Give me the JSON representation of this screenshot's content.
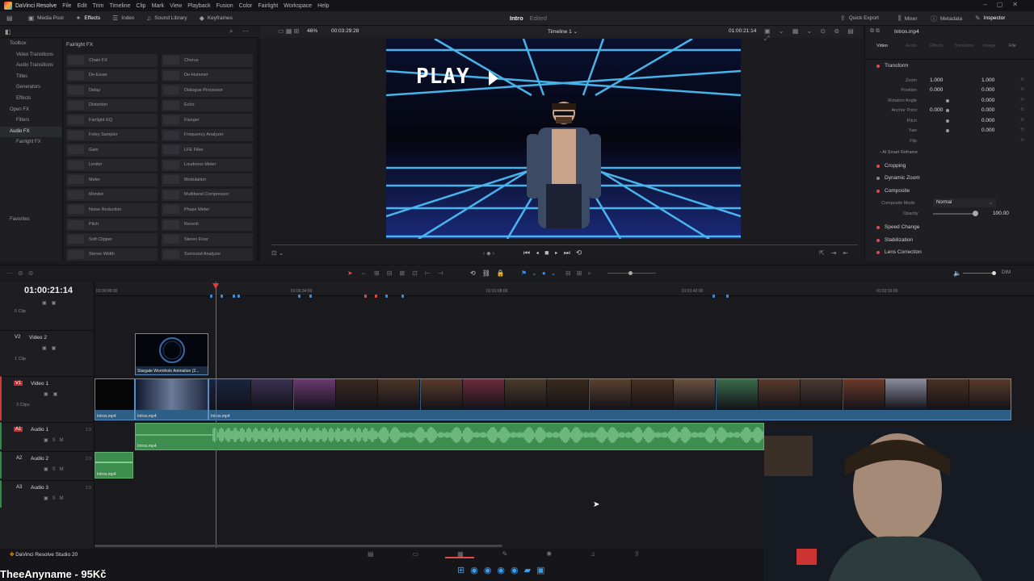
{
  "menu": {
    "app": "DaVinci Resolve",
    "items": [
      "File",
      "Edit",
      "Trim",
      "Timeline",
      "Clip",
      "Mark",
      "View",
      "Playback",
      "Fusion",
      "Color",
      "Fairlight",
      "Workspace",
      "Help"
    ]
  },
  "toolbar": {
    "left": [
      "Media Pool",
      "Effects",
      "Index",
      "Sound Library",
      "Keyframes"
    ],
    "project_name": "Intro",
    "project_status": "Edited",
    "right": [
      "Quick Export",
      "Mixer",
      "Metadata",
      "Inspector"
    ]
  },
  "effects": {
    "panel_title": "Fairlight FX",
    "tree": [
      {
        "label": "Toolbox",
        "indent": 0,
        "selected": false
      },
      {
        "label": "Video Transitions",
        "indent": 1,
        "selected": false
      },
      {
        "label": "Audio Transitions",
        "indent": 1,
        "selected": false
      },
      {
        "label": "Titles",
        "indent": 1,
        "selected": false
      },
      {
        "label": "Generators",
        "indent": 1,
        "selected": false
      },
      {
        "label": "Effects",
        "indent": 1,
        "selected": false
      },
      {
        "label": "Open FX",
        "indent": 0,
        "selected": false
      },
      {
        "label": "Filters",
        "indent": 1,
        "selected": false
      },
      {
        "label": "Audio FX",
        "indent": 0,
        "selected": true
      },
      {
        "label": "Fairlight FX",
        "indent": 1,
        "selected": false
      }
    ],
    "favorites_label": "Favorites",
    "items": [
      "Chain FX",
      "Chorus",
      "De-Esser",
      "De-Hummer",
      "Delay",
      "Dialogue Processor",
      "Distortion",
      "Echo",
      "Fairlight EQ",
      "Flanger",
      "Foley Sampler",
      "Frequency Analyzer",
      "Gain",
      "LFE Filter",
      "Limiter",
      "Loudness Meter",
      "Meter",
      "Modulation",
      "Monitor",
      "Multiband Compressor",
      "Noise Reduction",
      "Phase Meter",
      "Pitch",
      "Reverb",
      "Soft Clipper",
      "Stereo Fixer",
      "Stereo Width",
      "Surround Analyzer"
    ]
  },
  "viewer": {
    "zoom": "46%",
    "source_tc": "00:03:29:28",
    "timeline_name": "Timeline 1",
    "record_tc": "01:00:21:14",
    "overlay_text": "PLAY"
  },
  "inspector": {
    "clip_name": "Intros.mp4",
    "tabs": [
      "Video",
      "Audio",
      "Effects",
      "Transition",
      "Image",
      "File"
    ],
    "transform_label": "Transform",
    "rows": [
      {
        "label": "Zoom",
        "x": "1.000",
        "y": "1.000"
      },
      {
        "label": "Position",
        "x": "0.000",
        "y": "0.000"
      },
      {
        "label": "Rotation Angle",
        "x": "",
        "y": "0.000"
      },
      {
        "label": "Anchor Point",
        "x": "0.000",
        "y": "0.000"
      },
      {
        "label": "Pitch",
        "x": "",
        "y": "0.000"
      },
      {
        "label": "Yaw",
        "x": "",
        "y": "0.000"
      },
      {
        "label": "Flip",
        "x": "",
        "y": ""
      }
    ],
    "smart_reframe": "AI Smart Reframe",
    "sections_a": [
      "Cropping",
      "Dynamic Zoom",
      "Composite"
    ],
    "composite_mode_label": "Composite Mode",
    "composite_mode_value": "Normal",
    "opacity_label": "Opacity",
    "opacity_value": "100.00",
    "sections_b": [
      "Speed Change",
      "Stabilization",
      "Lens Correction"
    ]
  },
  "timeline": {
    "timecode": "01:00:21:14",
    "ruler": [
      "01:00:00:00",
      "01:00:34:00",
      "01:01:08:00",
      "01:01:42:00",
      "01:02:16:00"
    ],
    "mixer_level": "DIM",
    "top_track_clips": "0 Clip",
    "tracks": [
      {
        "id": "V2",
        "name": "Video 2",
        "clips": "1 Clip"
      },
      {
        "id": "V1",
        "name": "Video 1",
        "clips": "3 Clips"
      },
      {
        "id": "A1",
        "name": "Audio 1",
        "level": "2.0"
      },
      {
        "id": "A2",
        "name": "Audio 2",
        "level": "2.0"
      },
      {
        "id": "A3",
        "name": "Audio 3",
        "level": "2.0"
      }
    ],
    "clip_v2": "Stargate Wormhole Animation (2...",
    "clip_v1": "Intros.mp4",
    "clip_a": "Intros.mp4"
  },
  "status": {
    "app_version": "DaVinci Resolve Studio 20"
  },
  "stream_overlay": "TheeAnyname - 95Kč",
  "colors": {
    "accent": "#e04a4a",
    "video_clip": "#2d5e86",
    "audio_clip": "#3c8d4e",
    "playhead": "#e23b3b"
  }
}
